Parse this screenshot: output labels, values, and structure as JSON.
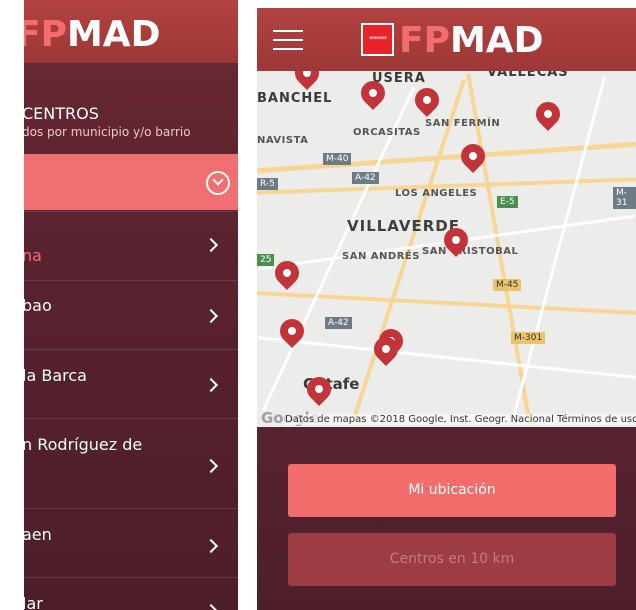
{
  "brand": {
    "logo_fp": "FP",
    "logo_mad": "MAD",
    "flag_stars": "*******"
  },
  "left": {
    "section_title": "CENTROS",
    "section_subtitle": "dos por municipio y/o barrio",
    "items": [
      {
        "label": "na",
        "highlight": true
      },
      {
        "label": "bao"
      },
      {
        "label": "la Barca"
      },
      {
        "label": "n Rodríguez de"
      },
      {
        "label": "aen"
      },
      {
        "label": "lar"
      }
    ]
  },
  "map": {
    "labels": {
      "usera": "USERA",
      "vallecas": "VALLECAS",
      "banchel": "BANCHEL",
      "sanfermin": "SAN FERMÍN",
      "orcasitas": "ORCASITAS",
      "navista": "NAVISTA",
      "losangeles": "LOS ANGELES",
      "villaverde": "VILLAVERDE",
      "sanandres": "SAN ANDRÉS",
      "sancristobal": "SAN CRISTOBAL",
      "getafe": "Getafe"
    },
    "shields": {
      "m40": "M-40",
      "a42a": "A-42",
      "r5": "R-5",
      "e5": "E-5",
      "m31": "M-31",
      "s25": "25",
      "m45": "M-45",
      "a42b": "A-42",
      "m301": "M-301"
    },
    "google_logo": "Google",
    "attribution": "Datos de mapas ©2018 Google, Inst. Geogr. Nacional    Términos de uso"
  },
  "buttons": {
    "my_location": "Mi ubicación",
    "nearby": "Centros en 10 km"
  },
  "colors": {
    "accent": "#f36d6d",
    "header": "#a33a3a",
    "pin": "#c3343a",
    "background": "#5a2230"
  }
}
